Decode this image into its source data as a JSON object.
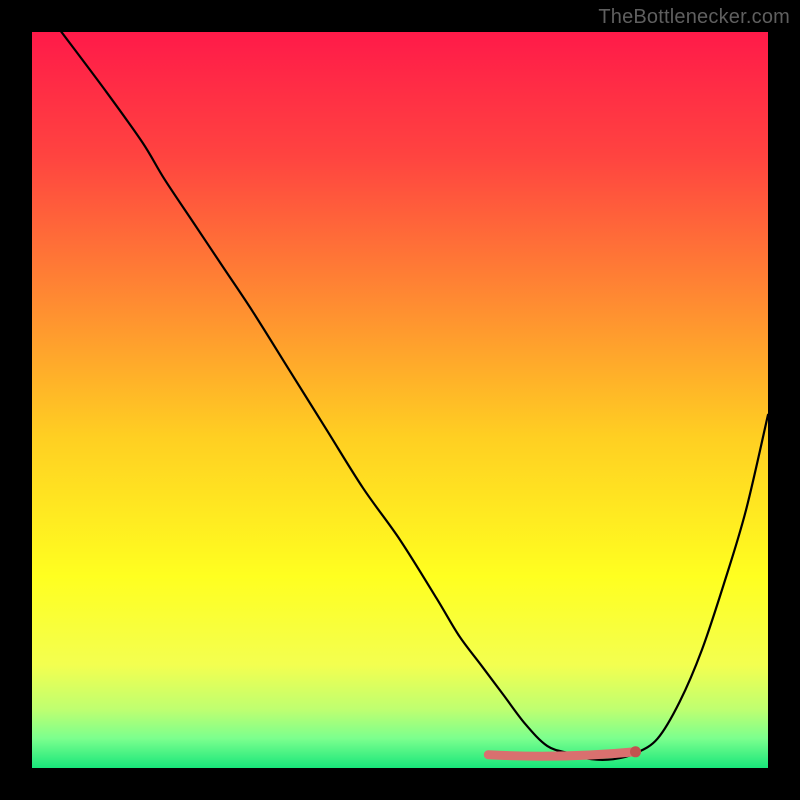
{
  "attribution": "TheBottlenecker.com",
  "colors": {
    "frame": "#000000",
    "gradient_stops": [
      {
        "offset": 0,
        "color": "#ff1a49"
      },
      {
        "offset": 0.17,
        "color": "#ff4440"
      },
      {
        "offset": 0.35,
        "color": "#ff8533"
      },
      {
        "offset": 0.55,
        "color": "#ffcf22"
      },
      {
        "offset": 0.74,
        "color": "#ffff20"
      },
      {
        "offset": 0.86,
        "color": "#f3ff50"
      },
      {
        "offset": 0.92,
        "color": "#bfff70"
      },
      {
        "offset": 0.96,
        "color": "#7bff8e"
      },
      {
        "offset": 1.0,
        "color": "#18e67a"
      }
    ],
    "curve": "#000000",
    "optimum_band": "#d9706f",
    "optimum_dot": "#c2524f"
  },
  "chart_data": {
    "type": "line",
    "title": "",
    "xlabel": "",
    "ylabel": "",
    "xlim": [
      0,
      100
    ],
    "ylim": [
      0,
      100
    ],
    "grid": false,
    "series": [
      {
        "name": "bottleneck-curve",
        "x": [
          4,
          10,
          15,
          18,
          22,
          26,
          30,
          35,
          40,
          45,
          50,
          55,
          58,
          61,
          64,
          67,
          70,
          73,
          76,
          79,
          82,
          85,
          88,
          91,
          94,
          97,
          100
        ],
        "y": [
          100,
          92,
          85,
          80,
          74,
          68,
          62,
          54,
          46,
          38,
          31,
          23,
          18,
          14,
          10,
          6,
          3,
          2,
          1.2,
          1.2,
          2,
          4,
          9,
          16,
          25,
          35,
          48
        ]
      }
    ],
    "annotations": [
      {
        "name": "optimum-band",
        "type": "segment",
        "x_start": 62,
        "x_end": 82,
        "y": 1.8
      },
      {
        "name": "optimum-dot",
        "type": "point",
        "x": 82,
        "y": 2.2
      }
    ],
    "notes": "x and y are read off an unlabeled 0–100 normalized axis; values are eyeball estimates from the rendered curve."
  }
}
